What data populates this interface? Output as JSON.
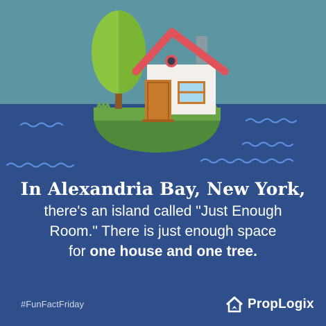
{
  "colors": {
    "sky": "#5d96a3",
    "water": "#2f4f8a",
    "wave": "#5a8fe0",
    "roof": "#e0525a",
    "house_wall": "#f3f0ec",
    "door": "#c87a2c",
    "tree": "#8cc53f",
    "island": "#4f8a3a"
  },
  "headline": {
    "line1": "In Alexandria Bay, New York,",
    "line2": "there's an island called \"Just Enough",
    "line3": "Room.\" There is just enough space",
    "line4_prefix": "for ",
    "line4_bold": "one house and one tree."
  },
  "footer": {
    "hashtag": "#FunFactFriday",
    "brand_name": "PropLogix"
  }
}
